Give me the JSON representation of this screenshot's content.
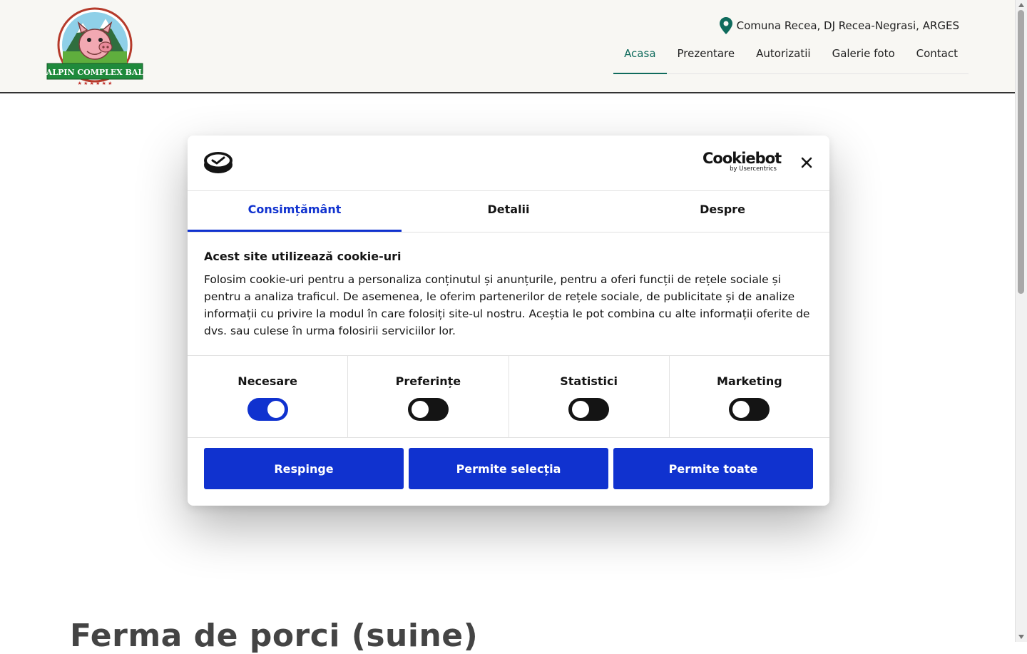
{
  "header": {
    "logo_text": "ALPIN COMPLEX BAL",
    "address": "Comuna Recea, DJ Recea-Negrasi, ARGES",
    "nav": [
      {
        "label": "Acasa"
      },
      {
        "label": "Prezentare"
      },
      {
        "label": "Autorizatii"
      },
      {
        "label": "Galerie foto"
      },
      {
        "label": "Contact"
      }
    ],
    "active_nav": "Acasa",
    "accent_color": "#0f6b5c"
  },
  "page": {
    "heading": "Ferma de porci (suine)"
  },
  "cookie_dialog": {
    "brand_name": "Cookiebot",
    "brand_sub": "by Usercentrics",
    "close_icon": "close-icon",
    "tabs": [
      {
        "label": "Consimțământ"
      },
      {
        "label": "Detalii"
      },
      {
        "label": "Despre"
      }
    ],
    "active_tab": "Consimțământ",
    "title": "Acest site utilizează cookie-uri",
    "body": "Folosim cookie-uri pentru a personaliza conținutul și anunțurile, pentru a oferi funcții de rețele sociale și pentru a analiza traficul. De asemenea, le oferim partenerilor de rețele sociale, de publicitate și de analize informații cu privire la modul în care folosiți site-ul nostru. Aceștia le pot combina cu alte informații oferite de dvs. sau culese în urma folosirii serviciilor lor.",
    "categories": [
      {
        "label": "Necesare",
        "enabled": true
      },
      {
        "label": "Preferințe",
        "enabled": false
      },
      {
        "label": "Statistici",
        "enabled": false
      },
      {
        "label": "Marketing",
        "enabled": false
      }
    ],
    "buttons": {
      "reject": "Respinge",
      "allow_selection": "Permite selecția",
      "allow_all": "Permite toate"
    },
    "button_color": "#1032cf"
  }
}
